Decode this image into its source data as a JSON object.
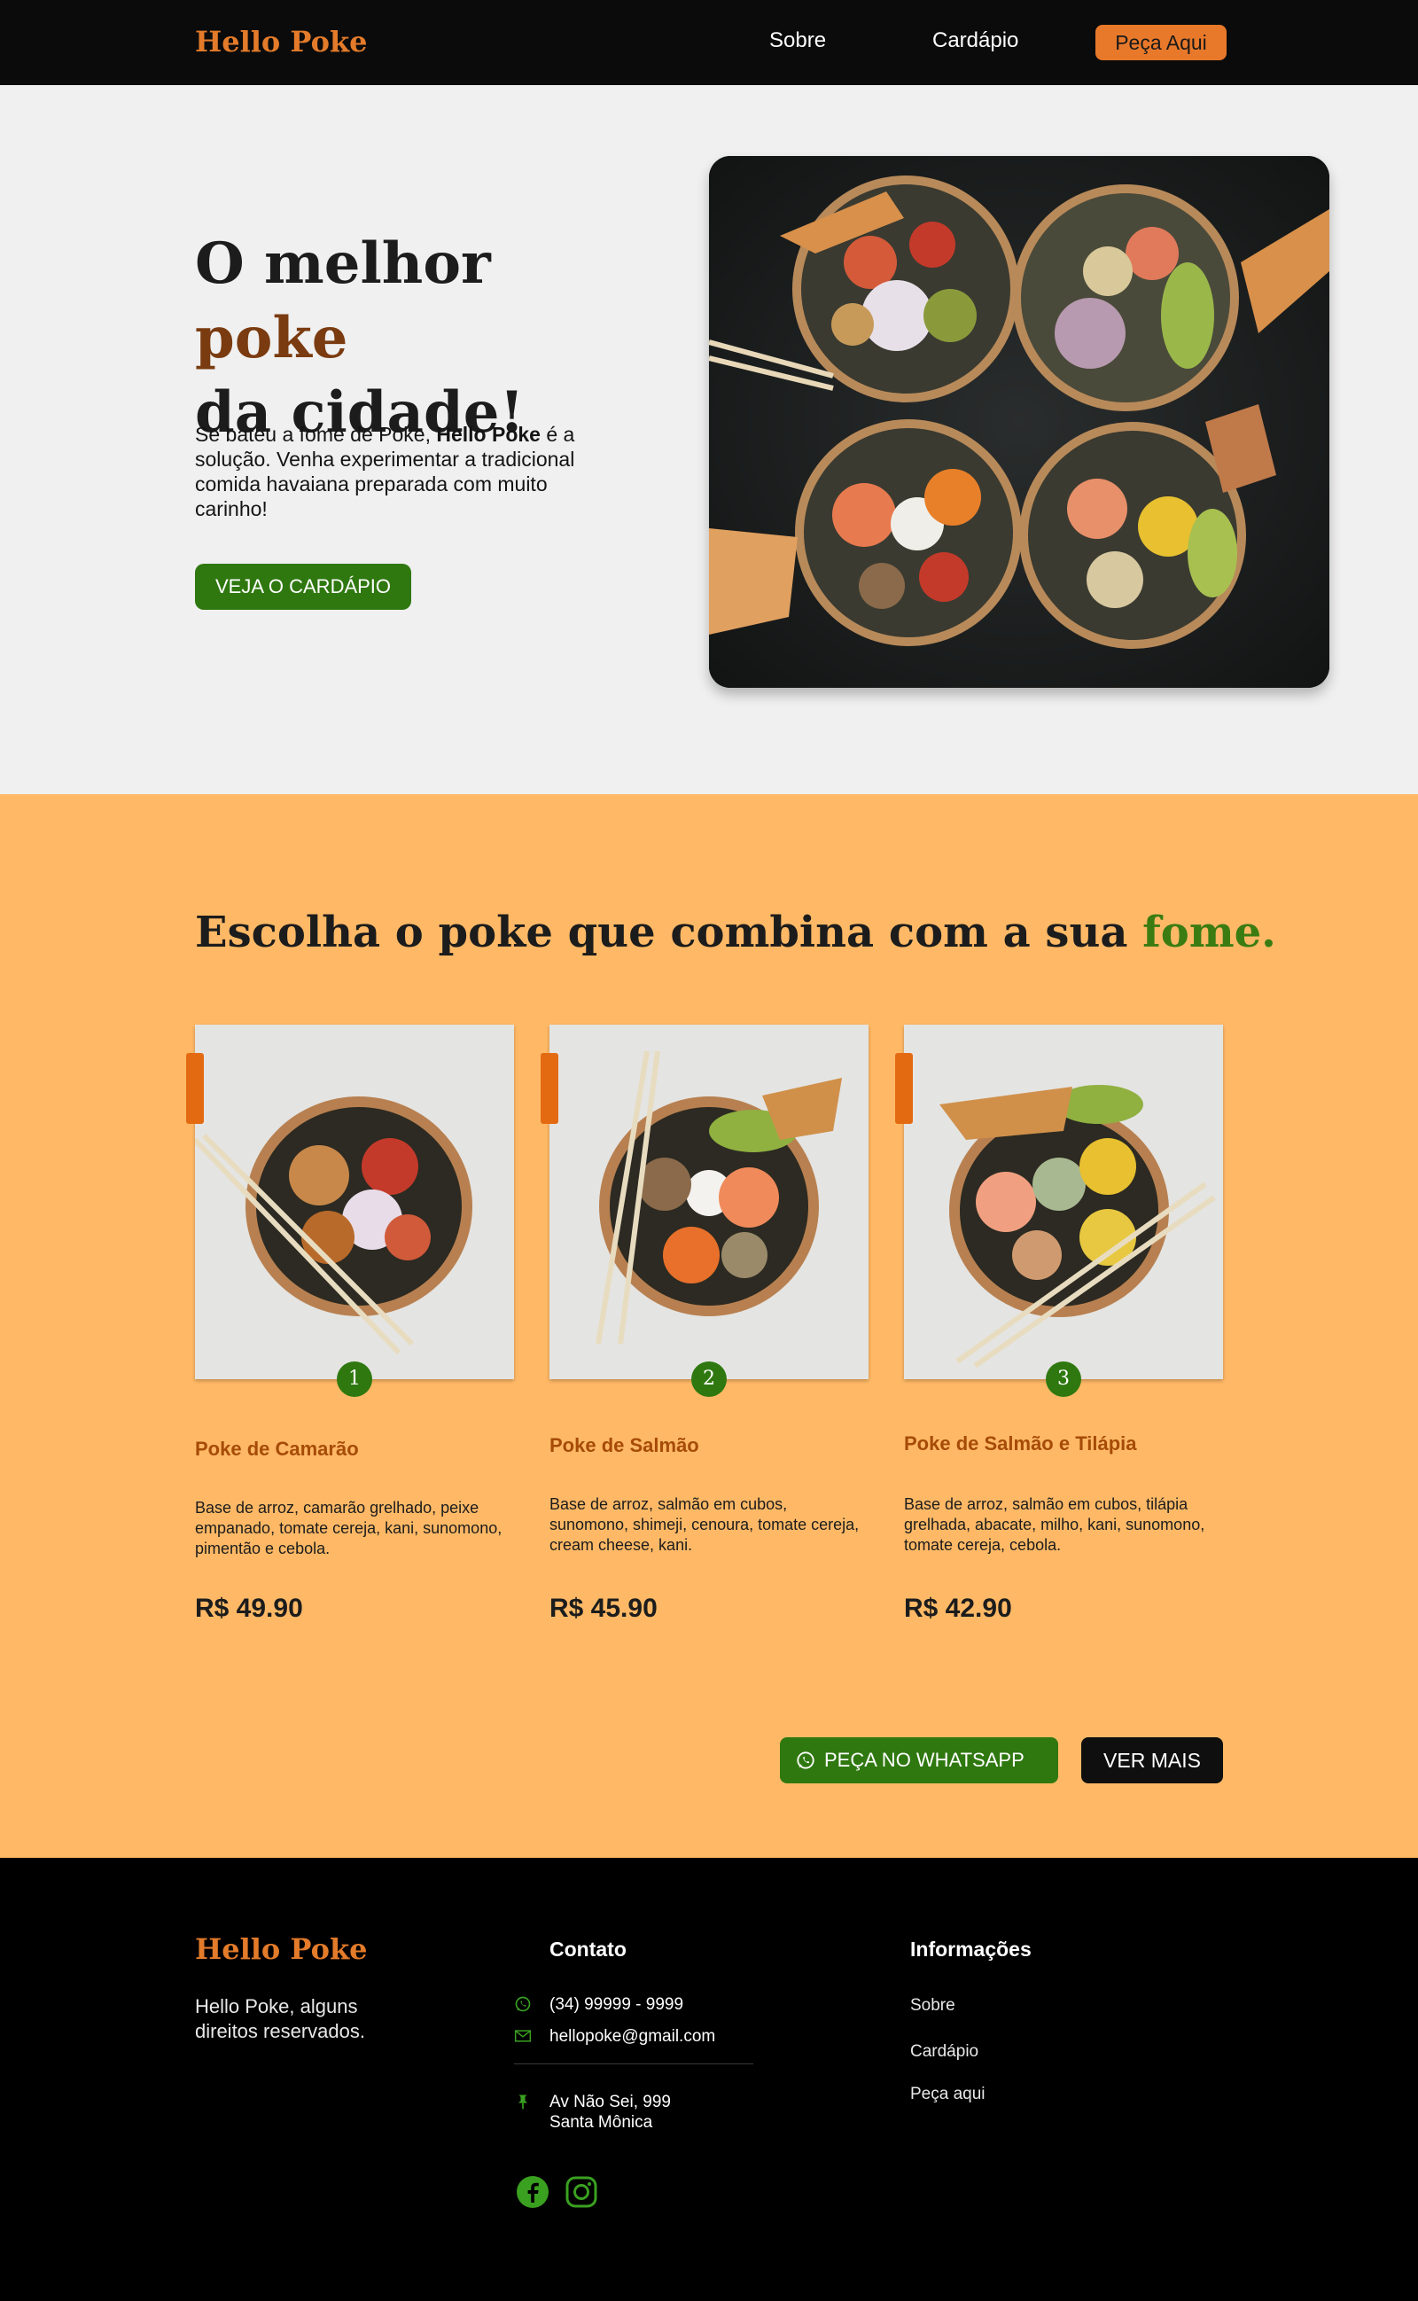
{
  "header": {
    "logo": "Hello Poke",
    "nav": {
      "about": "Sobre",
      "menu": "Cardápio",
      "order": "Peça Aqui"
    }
  },
  "hero": {
    "title_part1": "O melhor ",
    "title_accent": "poke",
    "title_part2": "da cidade!",
    "text_before": "Se bateu a fome de Poke, ",
    "text_bold": "Hello Poke",
    "text_after": " é a solução. Venha experimentar a tradicional comida havaiana preparada com muito carinho!",
    "button": "VEJA O CARDÁPIO"
  },
  "menu": {
    "title_main": "Escolha o poke que combina com a sua ",
    "title_accent": "fome.",
    "items": [
      {
        "number": "1",
        "name": "Poke de Camarão",
        "description": "Base de arroz,  camarão grelhado, peixe empanado, tomate cereja, kani, sunomono, pimentão e cebola.",
        "price": "R$ 49.90"
      },
      {
        "number": "2",
        "name": "Poke de Salmão",
        "description": "Base de arroz,  salmão em cubos, sunomono, shimeji, cenoura, tomate cereja, cream cheese, kani.",
        "price": "R$ 45.90"
      },
      {
        "number": "3",
        "name": "Poke de Salmão e Tilápia",
        "description": "Base de arroz,  salmão em cubos, tilápia grelhada, abacate, milho, kani, sunomono, tomate cereja, cebola.",
        "price": "R$ 42.90"
      }
    ],
    "whatsapp_button": "PEÇA NO WHATSAPP",
    "more_button": "VER MAIS"
  },
  "footer": {
    "logo": "Hello Poke",
    "rights": "Hello Poke, alguns direitos reservados.",
    "contact_title": "Contato",
    "phone": "(34) 99999 - 9999",
    "email": "hellopoke@gmail.com",
    "address_line1": "Av Não Sei, 999",
    "address_line2": "Santa Mônica",
    "info_title": "Informações",
    "links": {
      "about": "Sobre",
      "menu": "Cardápio",
      "order": "Peça aqui"
    }
  },
  "colors": {
    "brand_orange": "#e37b2a",
    "accent_green": "#2f7810",
    "menu_background": "#ffb966",
    "dark": "#0b0b0b"
  },
  "icons": [
    "whatsapp-icon",
    "mail-icon",
    "pin-icon",
    "facebook-icon",
    "instagram-icon"
  ]
}
